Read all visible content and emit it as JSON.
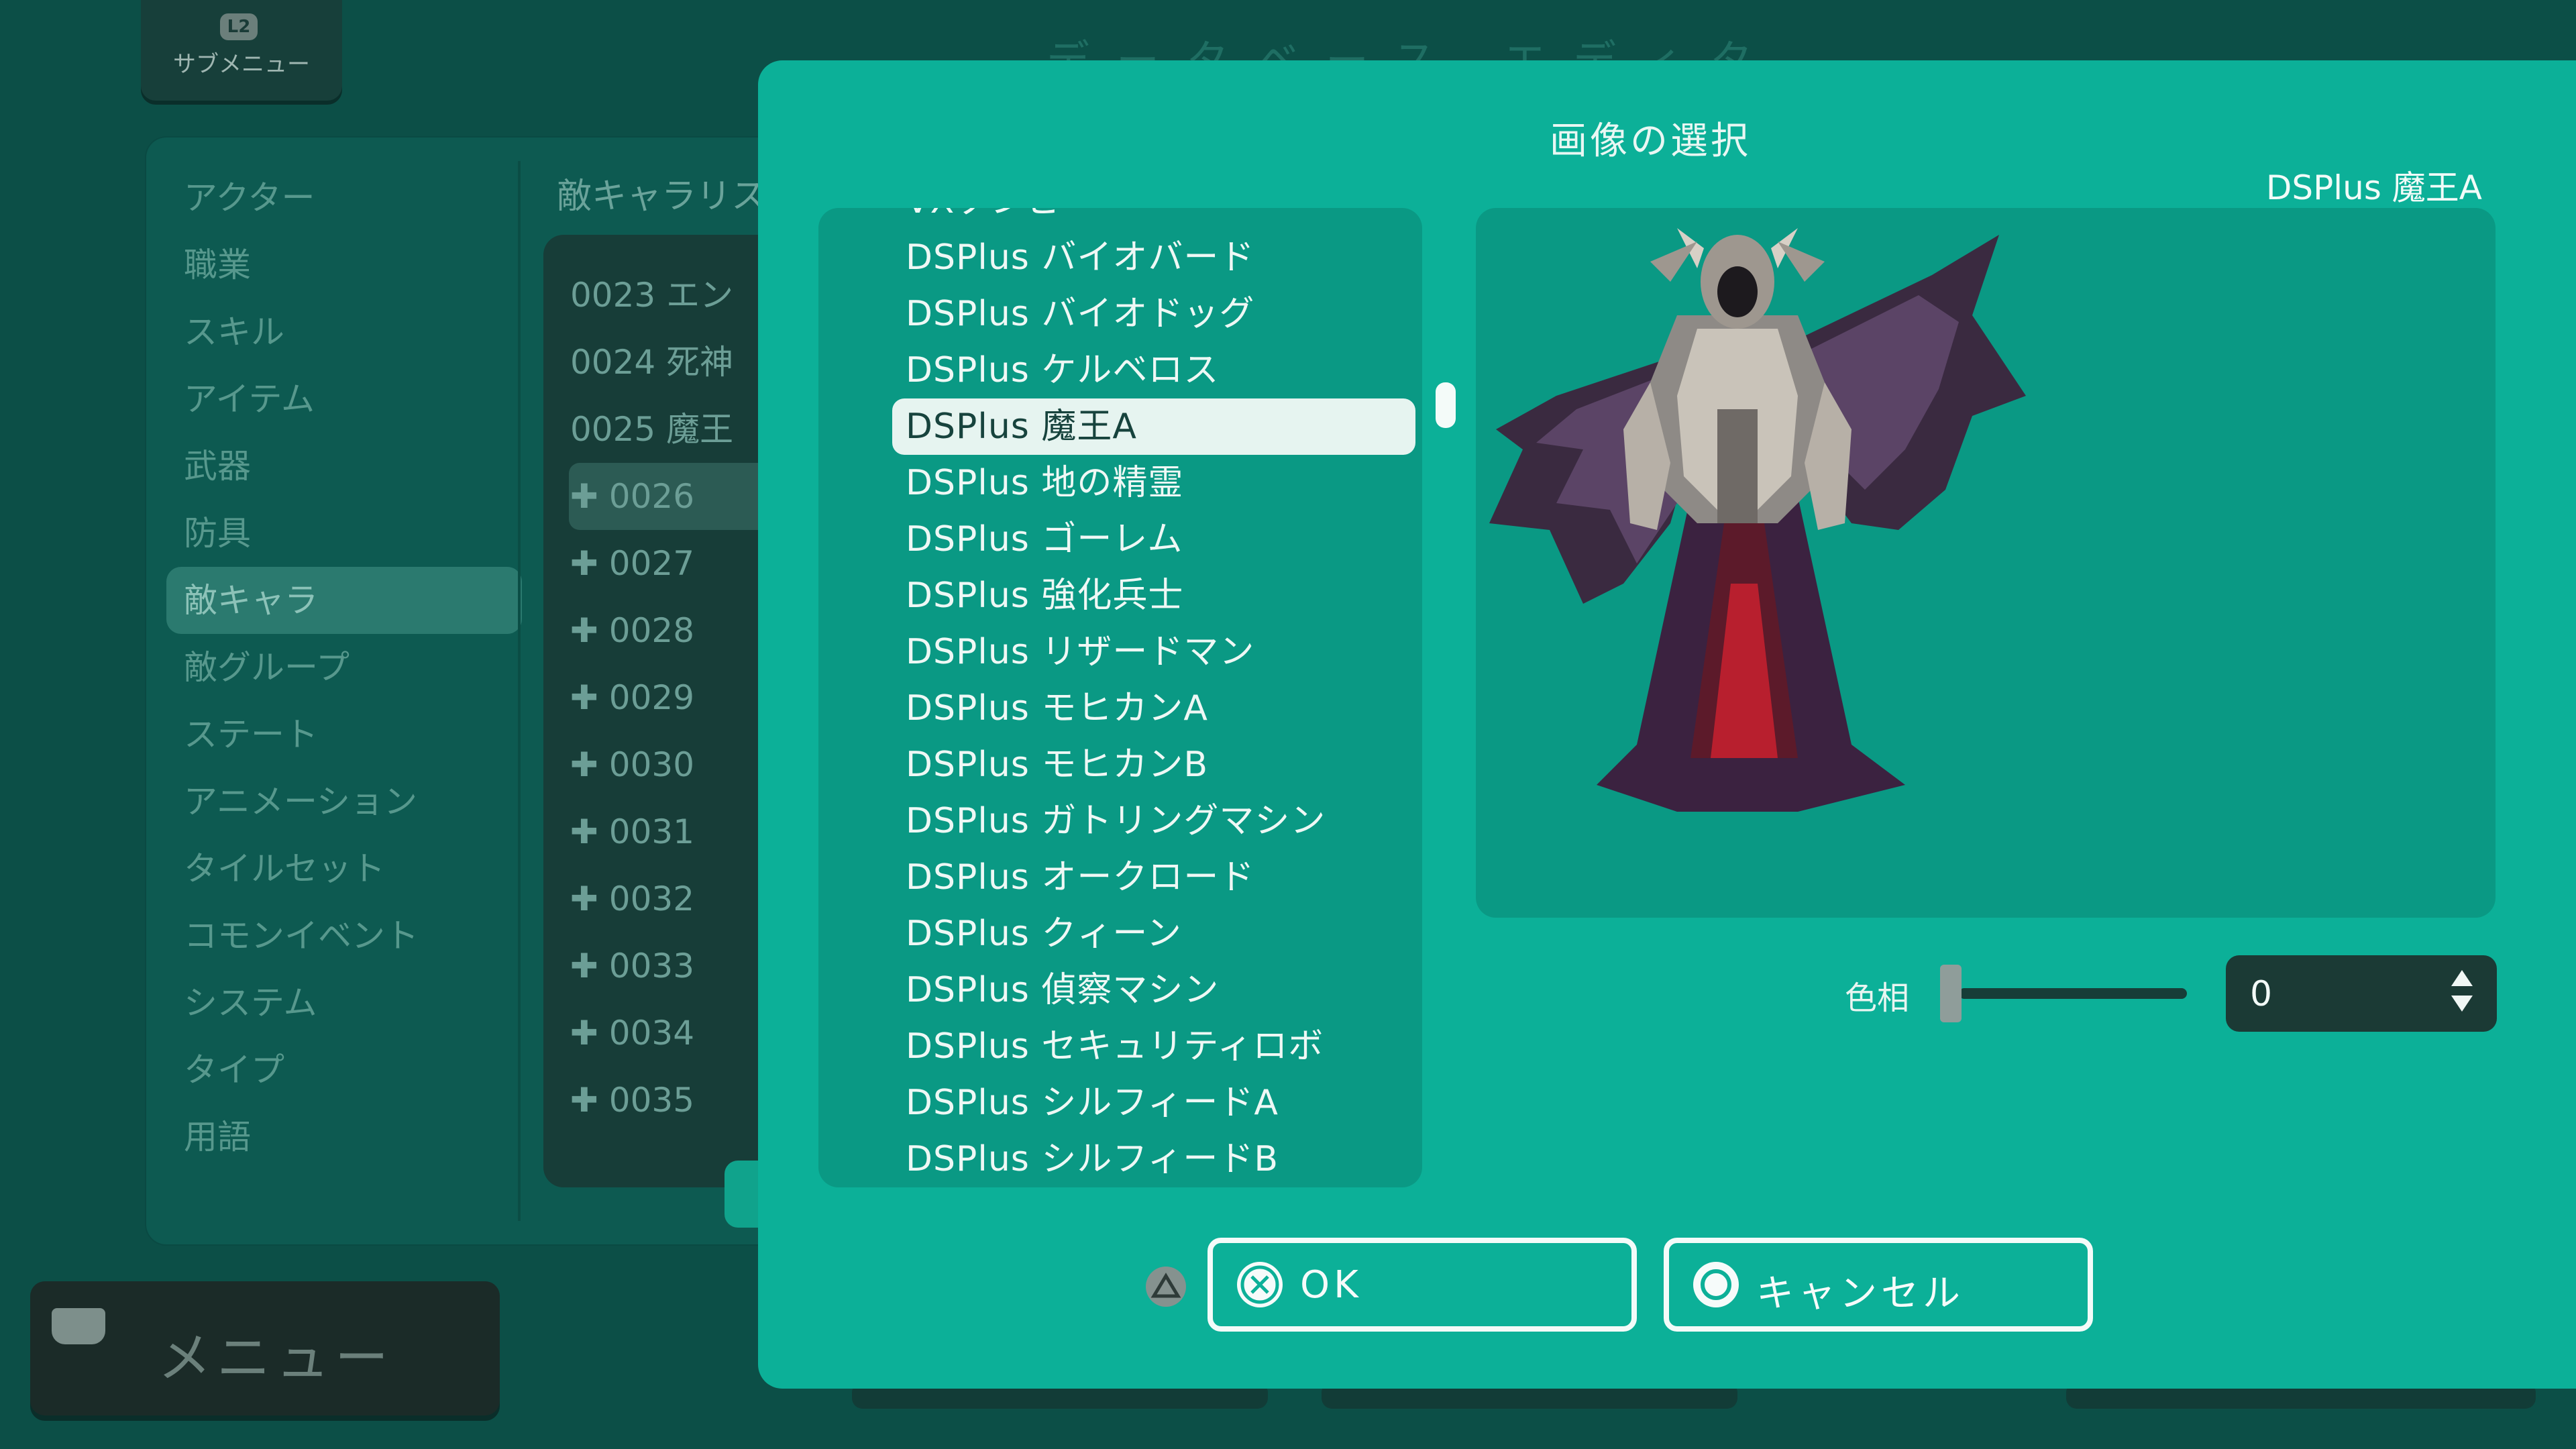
{
  "background": {
    "submenu": {
      "badge": "L2",
      "label": "サブメニュー"
    },
    "title": "データベース エディタ",
    "categories": [
      {
        "label": "アクター"
      },
      {
        "label": "職業"
      },
      {
        "label": "スキル"
      },
      {
        "label": "アイテム"
      },
      {
        "label": "武器"
      },
      {
        "label": "防具"
      },
      {
        "label": "敵キャラ"
      },
      {
        "label": "敵グループ"
      },
      {
        "label": "ステート"
      },
      {
        "label": "アニメーション"
      },
      {
        "label": "タイルセット"
      },
      {
        "label": "コモンイベント"
      },
      {
        "label": "システム"
      },
      {
        "label": "タイプ"
      },
      {
        "label": "用語"
      }
    ],
    "enemy_list_title": "敵キャラリス",
    "enemy_rows": [
      {
        "text": "0023 エン"
      },
      {
        "text": "0024 死神"
      },
      {
        "text": "0025 魔王"
      },
      {
        "text": "✚ 0026"
      },
      {
        "text": "✚ 0027"
      },
      {
        "text": "✚ 0028"
      },
      {
        "text": "✚ 0029"
      },
      {
        "text": "✚ 0030"
      },
      {
        "text": "✚ 0031"
      },
      {
        "text": "✚ 0032"
      },
      {
        "text": "✚ 0033"
      },
      {
        "text": "✚ 0034"
      },
      {
        "text": "✚ 0035"
      }
    ],
    "menu_button": {
      "label": "メニュー"
    }
  },
  "dialog": {
    "title": "画像の選択",
    "selected_name": "DSPlus 魔王A",
    "files": [
      {
        "label": "VXゾンビ"
      },
      {
        "label": "DSPlus バイオバード"
      },
      {
        "label": "DSPlus バイオドッグ"
      },
      {
        "label": "DSPlus ケルベロス"
      },
      {
        "label": "DSPlus 魔王A"
      },
      {
        "label": "DSPlus 地の精霊"
      },
      {
        "label": "DSPlus ゴーレム"
      },
      {
        "label": "DSPlus 強化兵士"
      },
      {
        "label": "DSPlus リザードマン"
      },
      {
        "label": "DSPlus モヒカンA"
      },
      {
        "label": "DSPlus モヒカンB"
      },
      {
        "label": "DSPlus ガトリングマシン"
      },
      {
        "label": "DSPlus オークロード"
      },
      {
        "label": "DSPlus クィーン"
      },
      {
        "label": "DSPlus 偵察マシン"
      },
      {
        "label": "DSPlus セキュリティロボ"
      },
      {
        "label": "DSPlus シルフィードA"
      },
      {
        "label": "DSPlus シルフィードB"
      }
    ],
    "hue": {
      "label": "色相",
      "value": "0"
    },
    "ok": {
      "label": "OK",
      "icon": "cross-icon"
    },
    "cancel": {
      "label": "キャンセル",
      "icon": "circle-icon"
    },
    "colors": {
      "dialog": "#0cb098",
      "list": "#0a9984",
      "selected": "#e6f4f0"
    }
  }
}
